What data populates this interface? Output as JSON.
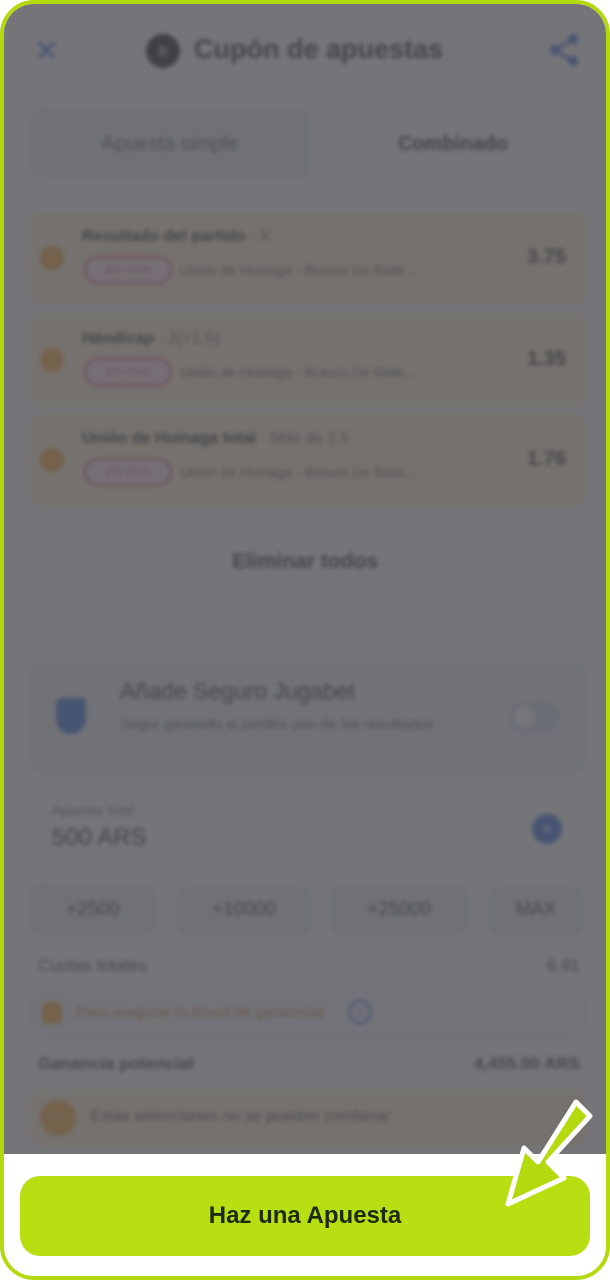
{
  "header": {
    "close_icon": "close-icon",
    "logo_text": "B",
    "title": "Cupón de apuestas",
    "share_icon": "share-icon"
  },
  "tabs": [
    {
      "label": "Apuesta simple",
      "active": false
    },
    {
      "label": "Combinado",
      "active": true
    }
  ],
  "selections": [
    {
      "market": "Resultado del partido",
      "pick": "X",
      "badge": "EN VIVO",
      "event": "Unión de Huinaga - Bravos De Ibaiti...",
      "odds": "3.75"
    },
    {
      "market": "Hándicap",
      "pick": "2(+1.5)",
      "badge": "EN VIVO",
      "event": "Unión de Huinaga - Bravos De Ibaiti...",
      "odds": "1.35"
    },
    {
      "market": "Unión de Huinaga total",
      "pick": "Más de 1.5",
      "badge": "EN VIVO",
      "event": "Unión de Huinaga - Bravos De Ibaiti...",
      "odds": "1.76"
    }
  ],
  "clear_all_label": "Eliminar todos",
  "insurance": {
    "title": "Añade Seguro Jugabet",
    "description": "Seguí ganando si perdés uno de los resultados",
    "enabled": false
  },
  "stake": {
    "label": "Apuesta total",
    "value": "500 ARS"
  },
  "quick_amounts": [
    "+2500",
    "+10000",
    "+25000",
    "MAX"
  ],
  "total_odds": {
    "label": "Cuotas totales",
    "value": "8.91"
  },
  "boost_text": "Para asegurar tu Boost de ganancias",
  "potential": {
    "label": "Ganancia potencial",
    "value": "4,455.00 ARS"
  },
  "warning": {
    "icon": "warning-icon",
    "text": "Estas selecciones no se pueden combinar"
  },
  "cta": {
    "label": "Haz una Apuesta"
  },
  "colors": {
    "accent": "#b7df12",
    "frame": "#b3d90f",
    "brand_blue": "#2c66d8"
  }
}
